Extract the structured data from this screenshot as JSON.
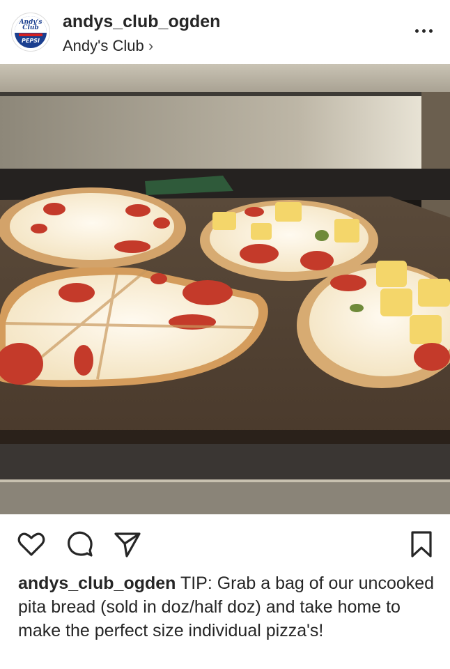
{
  "post": {
    "username": "andys_club_ogden",
    "location": "Andy's Club",
    "location_chevron": "›",
    "avatar": {
      "logo_line1": "Andy's",
      "logo_line2": "Club",
      "brand": "PEPSI"
    },
    "more_icon": "more-horizontal-icon",
    "photo_description_icon": "photo"
  },
  "actions": {
    "like_icon": "heart-outline-icon",
    "comment_icon": "comment-bubble-icon",
    "share_icon": "paper-plane-icon",
    "save_icon": "bookmark-icon"
  },
  "caption": {
    "username": "andys_club_ogden",
    "text": " TIP: Grab a bag of our uncooked pita bread (sold in doz/half doz) and take home to make the perfect size individual pizza's!"
  },
  "colors": {
    "text": "#262626",
    "brand_blue": "#1b3f8f",
    "brand_red": "#d62020"
  }
}
